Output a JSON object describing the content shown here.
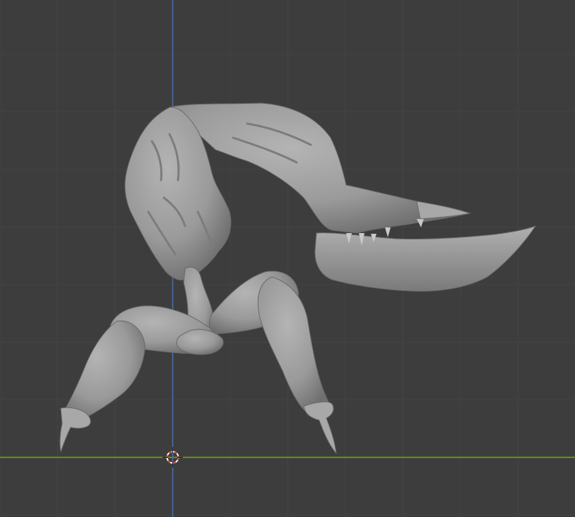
{
  "viewport": {
    "background": "#3d3d3d",
    "grid_minor_color": "#454545",
    "grid_major_color": "#4b4b4b",
    "axis_x_color": "#7da132",
    "axis_z_color": "#3a71c7",
    "mesh_color": "#9a9a9a"
  },
  "objects": {
    "mesh_name": "",
    "cursor_icon": "3d-cursor-icon"
  }
}
